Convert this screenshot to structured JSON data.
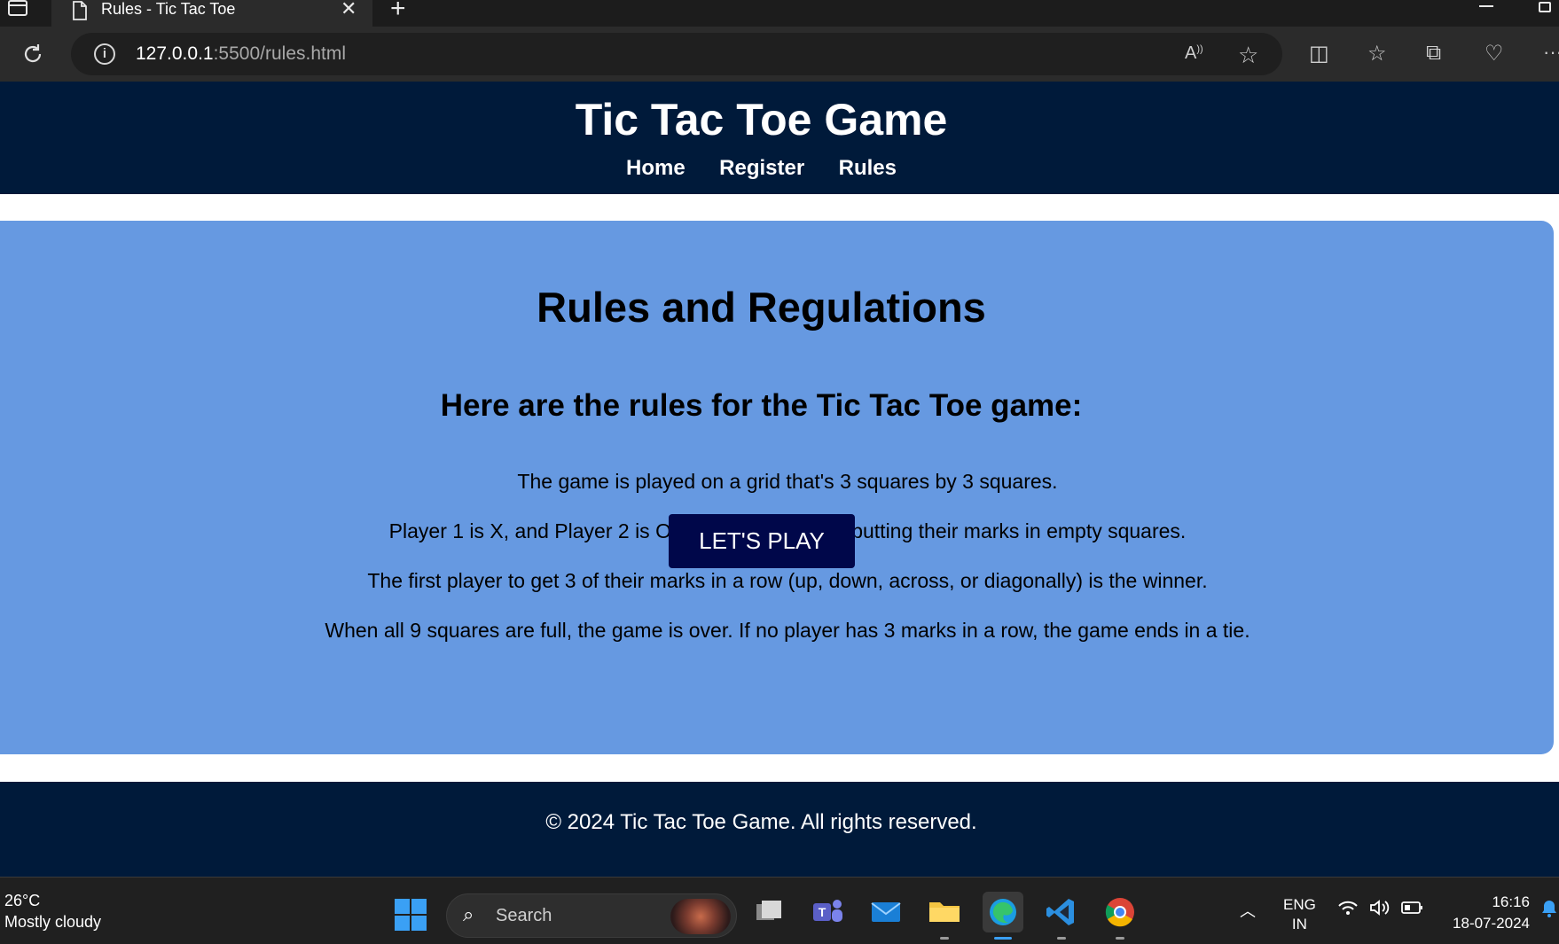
{
  "browser": {
    "tab_title": "Rules - Tic Tac Toe",
    "url_host": "127.0.0.1",
    "url_path": ":5500/rules.html"
  },
  "site": {
    "title": "Tic Tac Toe Game",
    "nav": [
      "Home",
      "Register",
      "Rules"
    ],
    "footer": "© 2024 Tic Tac Toe Game. All rights reserved."
  },
  "rules": {
    "heading": "Rules and Regulations",
    "subheading": "Here are the rules for the Tic Tac Toe game:",
    "items": [
      "The game is played on a grid that's 3 squares by 3 squares.",
      "Player 1 is X, and Player 2 is O. Players take turns putting their marks in empty squares.",
      "The first player to get 3 of their marks in a row (up, down, across, or diagonally) is the winner.",
      "When all 9 squares are full, the game is over. If no player has 3 marks in a row, the game ends in a tie."
    ],
    "play_button": "LET'S PLAY"
  },
  "taskbar": {
    "weather_temp": "26°C",
    "weather_desc": "Mostly cloudy",
    "search_label": "Search",
    "lang_top": "ENG",
    "lang_bottom": "IN",
    "time": "16:16",
    "date": "18-07-2024"
  },
  "colors": {
    "header_bg": "#001a3a",
    "card_bg": "#6699e1",
    "button_bg": "#00074a",
    "accent": "#3aa0f5"
  }
}
